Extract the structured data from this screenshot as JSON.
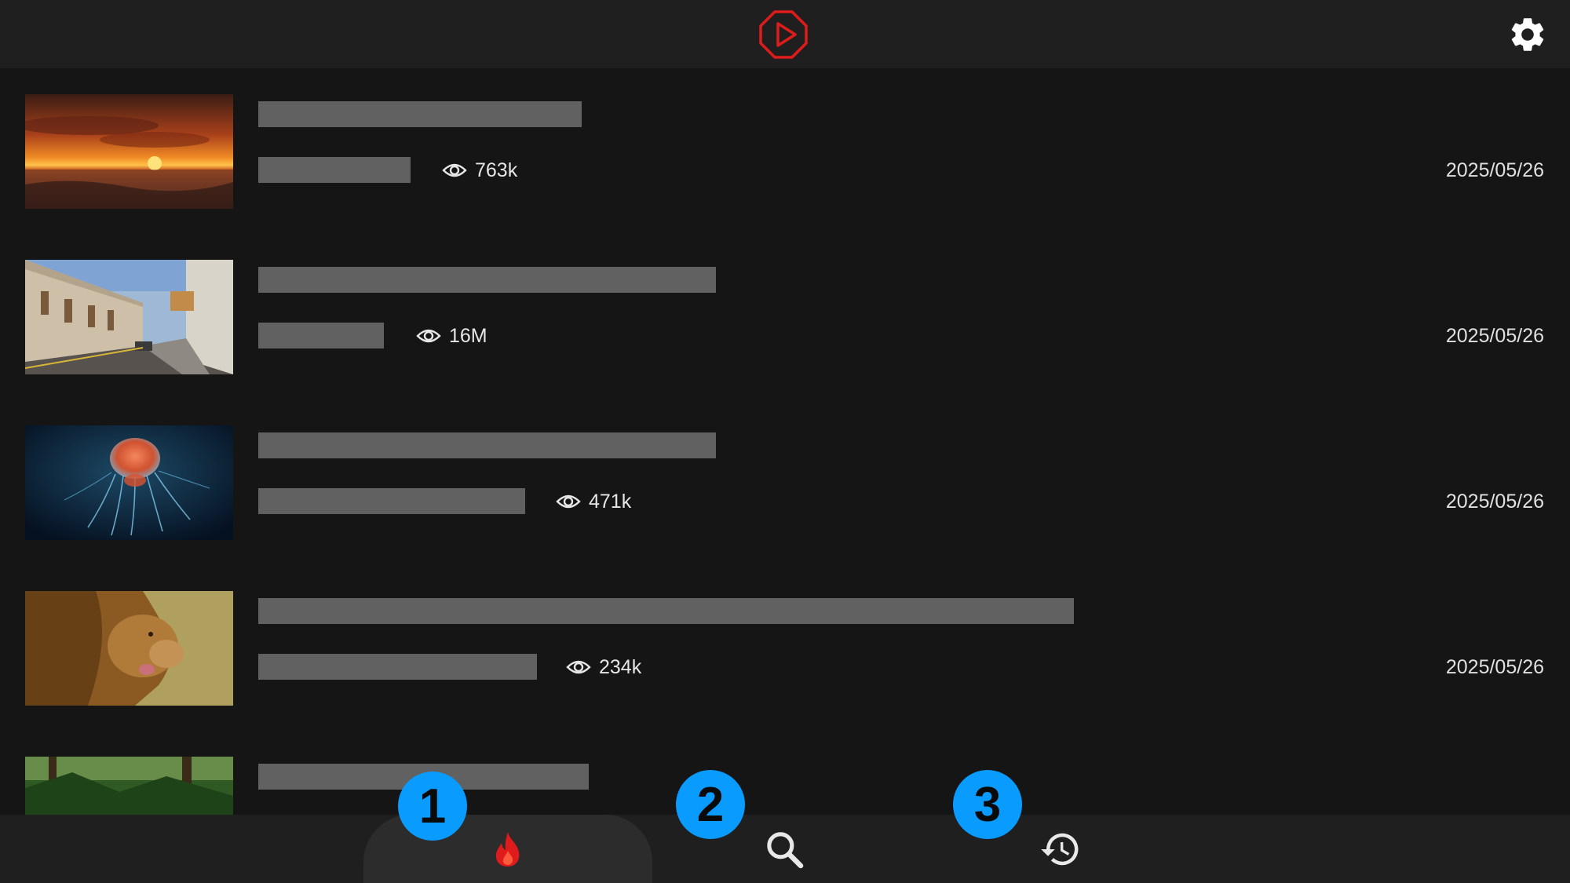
{
  "header": {
    "logo_icon": "play-octagon-icon",
    "settings_icon": "gear-icon",
    "accent_color": "#e01b1b"
  },
  "videos": [
    {
      "thumbnail": "sunset-over-ocean",
      "views": "763k",
      "date": "2025/05/26"
    },
    {
      "thumbnail": "colonial-street",
      "views": "16M",
      "date": "2025/05/26"
    },
    {
      "thumbnail": "jellyfish",
      "views": "471k",
      "date": "2025/05/26"
    },
    {
      "thumbnail": "lion",
      "views": "234k",
      "date": "2025/05/26"
    },
    {
      "thumbnail": "forest"
    }
  ],
  "bottom_nav": {
    "tabs": [
      {
        "icon": "fire-icon",
        "active": true,
        "badge": "1"
      },
      {
        "icon": "search-icon",
        "active": false,
        "badge": "2"
      },
      {
        "icon": "history-icon",
        "active": false,
        "badge": "3"
      }
    ]
  }
}
